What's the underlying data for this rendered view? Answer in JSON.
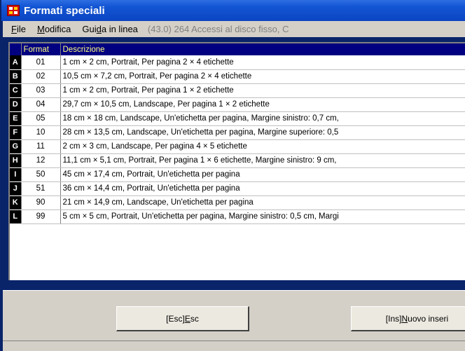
{
  "window": {
    "title": "Formati speciali",
    "accent_color": "#0b44c2",
    "app_icon": "app-icon"
  },
  "menu": {
    "items": [
      {
        "label": "File",
        "underline": "F",
        "rest": "ile"
      },
      {
        "label": "Modifica",
        "underline": "M",
        "rest": "odifica"
      },
      {
        "pre": "Gui",
        "underline": "d",
        "rest": "a in linea"
      }
    ],
    "status": "(43.0) 264 Accessi al disco fisso, C"
  },
  "grid": {
    "columns": [
      "Format",
      "Descrizione"
    ],
    "header_color": "#000080",
    "rows": [
      {
        "key": "A",
        "format": "01",
        "description": "1 cm × 2 cm, Portrait, Per pagina 2 × 4 etichette"
      },
      {
        "key": "B",
        "format": "02",
        "description": "10,5 cm × 7,2 cm, Portrait, Per pagina 2 × 4 etichette"
      },
      {
        "key": "C",
        "format": "03",
        "description": "1 cm × 2 cm, Portrait, Per pagina 1 × 2 etichette"
      },
      {
        "key": "D",
        "format": "04",
        "description": "29,7 cm × 10,5 cm, Landscape, Per pagina 1 × 2 etichette"
      },
      {
        "key": "E",
        "format": "05",
        "description": "18 cm × 18 cm, Landscape, Un'etichetta per pagina, Margine sinistro: 0,7 cm,"
      },
      {
        "key": "F",
        "format": "10",
        "description": "28 cm × 13,5 cm, Landscape, Un'etichetta per pagina, Margine superiore: 0,5"
      },
      {
        "key": "G",
        "format": "11",
        "description": "2 cm × 3 cm, Landscape, Per pagina 4 × 5 etichette"
      },
      {
        "key": "H",
        "format": "12",
        "description": "11,1 cm × 5,1 cm, Portrait, Per pagina 1 × 6 etichette, Margine sinistro: 9 cm,"
      },
      {
        "key": "I",
        "format": "50",
        "description": "45 cm × 17,4 cm, Portrait, Un'etichetta per pagina"
      },
      {
        "key": "J",
        "format": "51",
        "description": "36 cm × 14,4 cm, Portrait, Un'etichetta per pagina"
      },
      {
        "key": "K",
        "format": "90",
        "description": "21 cm × 14,9 cm, Landscape, Un'etichetta per pagina"
      },
      {
        "key": "L",
        "format": "99",
        "description": "5 cm × 5 cm, Portrait, Un'etichetta per pagina, Margine sinistro: 0,5 cm, Margi"
      }
    ]
  },
  "buttons": {
    "esc": {
      "pre": "[Esc] ",
      "underline": "E",
      "rest": "sc"
    },
    "ins": {
      "pre": "[Ins] ",
      "underline": "N",
      "rest": "uovo inseri"
    }
  }
}
